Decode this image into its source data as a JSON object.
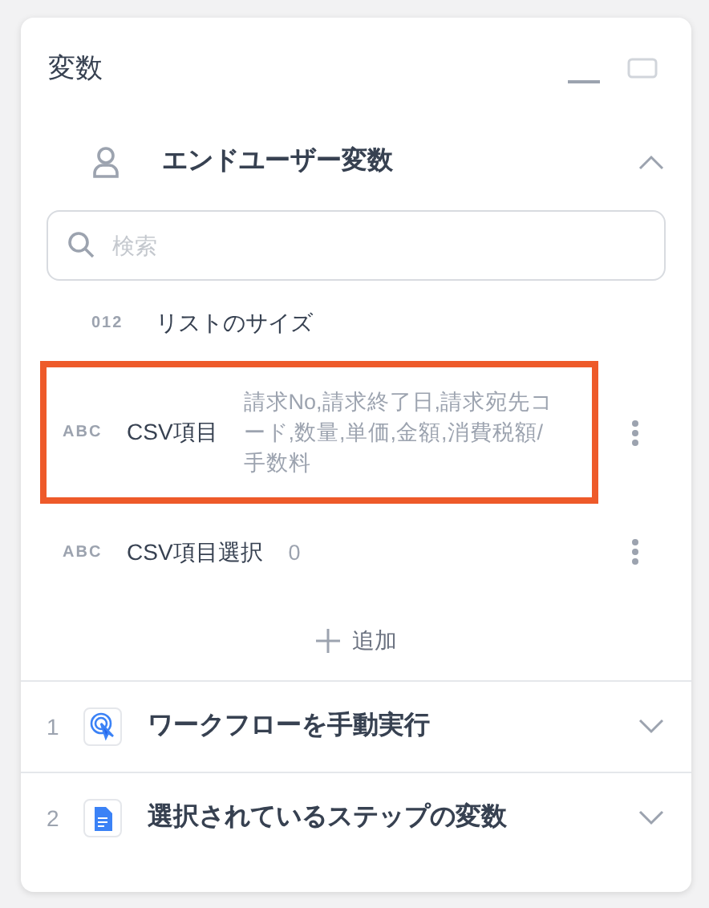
{
  "panel": {
    "title": "変数"
  },
  "user_section": {
    "title": "エンドユーザー変数",
    "expanded": true,
    "search": {
      "placeholder": "検索"
    },
    "variables": [
      {
        "type": "012",
        "name": "リストのサイズ",
        "highlighted": false,
        "menu": false
      },
      {
        "type": "ABC",
        "name": "CSV項目",
        "value": "請求No,請求終了日,請求宛先コード,数量,単価,金額,消費税額/手数料",
        "highlighted": true,
        "menu": true
      },
      {
        "type": "ABC",
        "name": "CSV項目選択",
        "value": "0",
        "highlighted": false,
        "menu": true
      }
    ],
    "add_button": "追加"
  },
  "steps": [
    {
      "number": "1",
      "kind": "trigger",
      "title": "ワークフローを手動実行",
      "expanded": false
    },
    {
      "number": "2",
      "kind": "document",
      "title": "選択されているステップの変数",
      "expanded": false
    }
  ]
}
